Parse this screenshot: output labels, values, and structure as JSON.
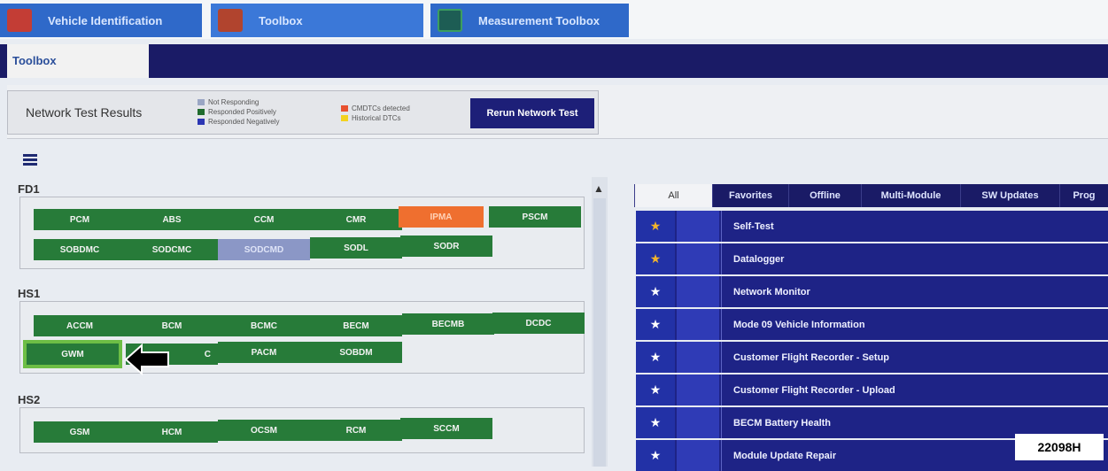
{
  "top_tabs": [
    {
      "label": "Vehicle Identification"
    },
    {
      "label": "Toolbox"
    },
    {
      "label": "Measurement Toolbox"
    }
  ],
  "subtab": {
    "label": "Toolbox"
  },
  "network": {
    "title": "Network Test Results",
    "legend": [
      {
        "label": "Not Responding",
        "color": "#9aa6c4"
      },
      {
        "label": "Responded Positively",
        "color": "#1f6b2e"
      },
      {
        "label": "Responded Negatively",
        "color": "#2b36b3"
      },
      {
        "label": "CMDTCs detected",
        "color": "#e8512f"
      },
      {
        "label": "Historical DTCs",
        "color": "#f3d21f"
      }
    ],
    "rerun_label": "Rerun Network Test"
  },
  "groups": {
    "fd1": {
      "title": "FD1",
      "modules": [
        "PCM",
        "ABS",
        "CCM",
        "CMR",
        "IPMA",
        "PSCM",
        "SOBDMC",
        "SODCMC",
        "SODCMD",
        "SODL",
        "SODR"
      ]
    },
    "hs1": {
      "title": "HS1",
      "modules": [
        "ACCM",
        "BCM",
        "BCMC",
        "BECM",
        "BECMB",
        "DCDC",
        "GWM",
        "C",
        "PACM",
        "SOBDM"
      ]
    },
    "hs2": {
      "title": "HS2",
      "modules": [
        "GSM",
        "HCM",
        "OCSM",
        "RCM",
        "SCCM"
      ]
    }
  },
  "right_tabs": [
    "All",
    "Favorites",
    "Offline",
    "Multi-Module",
    "SW Updates",
    "Prog"
  ],
  "tools": [
    {
      "label": "Self-Test",
      "favorite": true
    },
    {
      "label": "Datalogger",
      "favorite": true
    },
    {
      "label": "Network Monitor",
      "favorite": false
    },
    {
      "label": "Mode 09 Vehicle Information",
      "favorite": false
    },
    {
      "label": "Customer Flight Recorder - Setup",
      "favorite": false
    },
    {
      "label": "Customer Flight Recorder - Upload",
      "favorite": false
    },
    {
      "label": "BECM Battery Health",
      "favorite": false
    },
    {
      "label": "Module Update Repair",
      "favorite": false
    }
  ],
  "figure_label": "22098H"
}
